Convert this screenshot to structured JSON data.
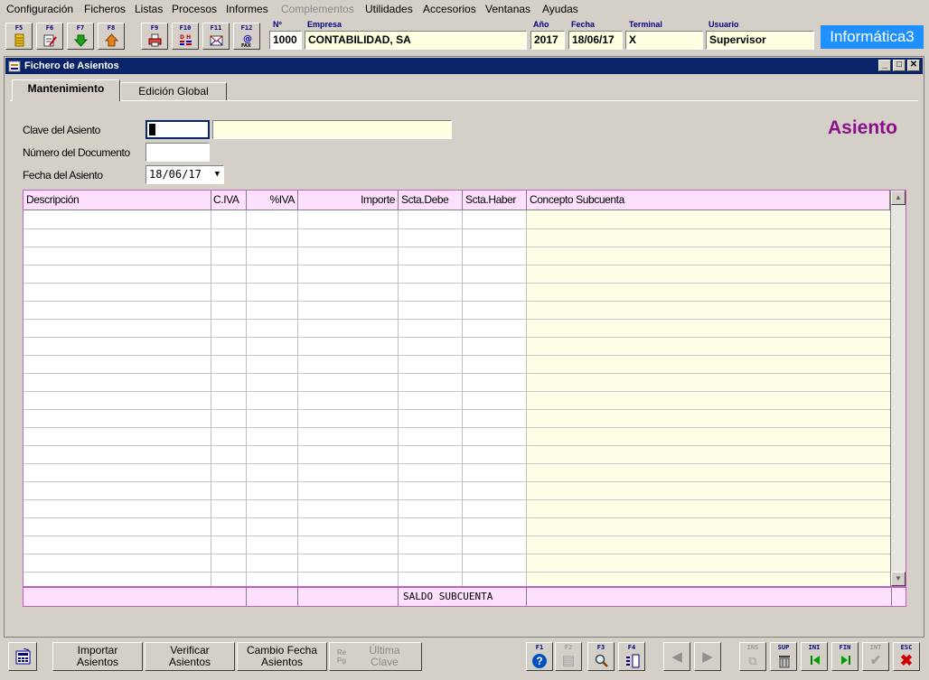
{
  "menu": [
    {
      "label": "Configuración",
      "enabled": true
    },
    {
      "label": "Ficheros",
      "enabled": true
    },
    {
      "label": "Listas",
      "enabled": true
    },
    {
      "label": "Procesos",
      "enabled": true
    },
    {
      "label": "Informes",
      "enabled": true
    },
    {
      "label": "Complementos",
      "enabled": false
    },
    {
      "label": "Utilidades",
      "enabled": true
    },
    {
      "label": "Accesorios",
      "enabled": true
    },
    {
      "label": "Ventanas",
      "enabled": true
    },
    {
      "label": "Ayudas",
      "enabled": true
    }
  ],
  "toolbar": {
    "buttons": [
      {
        "key": "F5",
        "icon": "ledger-icon"
      },
      {
        "key": "F6",
        "icon": "edit-document-icon"
      },
      {
        "key": "F7",
        "icon": "import-arrow-icon"
      },
      {
        "key": "F8",
        "icon": "export-arrow-icon"
      },
      {
        "key": "F9",
        "icon": "print-icon"
      },
      {
        "key": "F10",
        "icon": "debit-credit-icon"
      },
      {
        "key": "F11",
        "icon": "envelope-icon"
      },
      {
        "key": "F12",
        "icon": "fax-email-icon"
      }
    ],
    "fields": {
      "no_label": "Nº",
      "no_value": "1000",
      "empresa_label": "Empresa",
      "empresa_value": "CONTABILIDAD, SA",
      "anio_label": "Año",
      "anio_value": "2017",
      "fecha_label": "Fecha",
      "fecha_value": "18/06/17",
      "terminal_label": "Terminal",
      "terminal_value": "X",
      "usuario_label": "Usuario",
      "usuario_value": "Supervisor"
    },
    "brand": "Informática3"
  },
  "window": {
    "title": "Fichero de Asientos",
    "tabs": [
      {
        "label": "Mantenimiento",
        "active": true
      },
      {
        "label": "Edición Global",
        "active": false
      }
    ]
  },
  "form": {
    "clave_label": "Clave del Asiento",
    "clave_value": "",
    "clave_desc": "",
    "numero_label": "Número del Documento",
    "numero_value": "",
    "fecha_label": "Fecha del Asiento",
    "fecha_value": "18/06/17",
    "heading": "Asiento"
  },
  "grid": {
    "columns": [
      "Descripción",
      "C.IVA",
      "%IVA",
      "Importe",
      "Scta.Debe",
      "Scta.Haber",
      "Concepto Subcuenta"
    ],
    "rows": [],
    "footer": {
      "label": "SALDO SUBCUENTA",
      "value": ""
    }
  },
  "bottom": {
    "buttons": [
      {
        "label": "Importar Asientos",
        "enabled": true
      },
      {
        "label": "Verificar Asientos",
        "enabled": true
      },
      {
        "label": "Cambio Fecha Asientos",
        "enabled": true
      },
      {
        "label": "Última Clave",
        "prefix": "Re Pg",
        "enabled": false
      }
    ],
    "function_keys": [
      {
        "key": "F1",
        "icon": "help-icon",
        "enabled": true
      },
      {
        "key": "F2",
        "icon": "list-icon",
        "enabled": false
      },
      {
        "key": "F3",
        "icon": "search-icon",
        "enabled": true
      },
      {
        "key": "F4",
        "icon": "columns-icon",
        "enabled": true
      }
    ],
    "record_keys": [
      {
        "key": "INS",
        "icon": "insert-copy-icon",
        "enabled": false
      },
      {
        "key": "SUP",
        "icon": "trash-icon",
        "enabled": true
      },
      {
        "key": "INI",
        "icon": "first-record-icon",
        "enabled": true
      },
      {
        "key": "FIN",
        "icon": "last-record-icon",
        "enabled": true
      },
      {
        "key": "INT",
        "icon": "check-icon",
        "enabled": false
      },
      {
        "key": "ESC",
        "icon": "close-icon",
        "enabled": true
      }
    ]
  }
}
